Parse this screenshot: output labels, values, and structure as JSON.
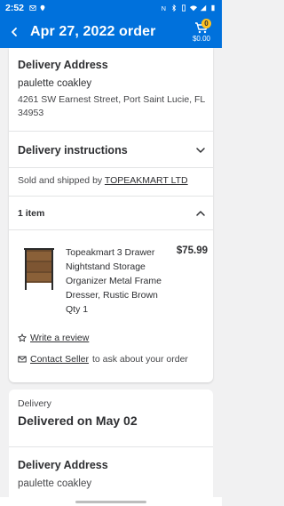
{
  "status_bar": {
    "time": "2:52"
  },
  "header": {
    "title": "Apr 27, 2022 order",
    "cart_count": "0",
    "cart_total": "$0.00"
  },
  "order": {
    "delivery_address": {
      "title": "Delivery Address",
      "name": "paulette coakley",
      "address": "4261 SW Earnest Street, Port Saint Lucie, FL 34953"
    },
    "delivery_instructions": {
      "title": "Delivery instructions"
    },
    "seller": {
      "prefix": "Sold and shipped by",
      "name": "TOPEAKMART LTD"
    },
    "items_header": {
      "label": "1 item"
    },
    "items": [
      {
        "name": "Topeakmart 3 Drawer Nightstand Storage Organizer Metal Frame Dresser, Rustic Brown",
        "price": "$75.99",
        "qty": "Qty 1"
      }
    ],
    "actions": {
      "review_label": "Write a review",
      "contact_label": "Contact Seller",
      "contact_suffix": "to ask about your order"
    }
  },
  "delivery_status": {
    "label": "Delivery",
    "status": "Delivered on May 02",
    "address_title": "Delivery Address",
    "name": "paulette coakley"
  },
  "colors": {
    "brand_blue": "#0071dc",
    "badge_yellow": "#ffc220",
    "text_dark": "#2e2f32"
  }
}
